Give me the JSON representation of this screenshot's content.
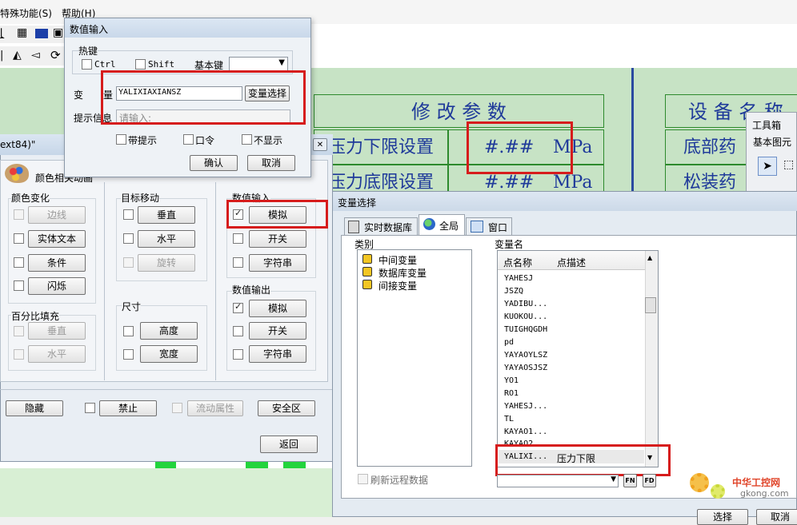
{
  "menubar": {
    "special": "特殊功能(S)",
    "help": "帮助(H)"
  },
  "hmi": {
    "panel_title": "修 改 参 数",
    "row1_label": "压力下限设置",
    "row1_value": "#.##",
    "row1_unit": "MPa",
    "row2_label": "压力底限设置",
    "row2_value": "#.##",
    "row2_unit": "MPa",
    "equip_title": "设 备 名 称",
    "equip_row1": "底部药",
    "equip_row2": "松装药"
  },
  "toolbox": {
    "title": "工具箱",
    "section": "基本图元"
  },
  "numeric_dialog": {
    "title": "数值输入",
    "hotkey_label": "热键",
    "ctrl_label": "Ctrl",
    "shift_label": "Shift",
    "basekey_label": "基本键",
    "var_label_a": "变",
    "var_label_b": "量",
    "var_value": "YALIXIAXIANSZ",
    "var_select_button": "变量选择",
    "prompt_label": "提示信息",
    "prompt_placeholder": "请输入:",
    "with_prompt": "带提示",
    "password": "口令",
    "no_display": "不显示",
    "ok": "确认",
    "cancel": "取消"
  },
  "animation_dialog": {
    "title_fragment": "ext84)\"",
    "close_glyph": "✕",
    "tab_color": "颜色相关动画",
    "color_change": "颜色变化",
    "edge": "边线",
    "solid_text": "实体文本",
    "condition": "条件",
    "blink": "闪烁",
    "percent_fill": "百分比填充",
    "vertical": "垂直",
    "horizontal": "水平",
    "target_move": "目标移动",
    "move_vertical": "垂直",
    "move_horizontal": "水平",
    "rotate": "旋转",
    "size": "尺寸",
    "height": "高度",
    "width": "宽度",
    "value_input": "数值输入",
    "in_analog": "模拟",
    "in_switch": "开关",
    "in_string": "字符串",
    "value_output": "数值输出",
    "out_analog": "模拟",
    "out_switch": "开关",
    "out_string": "字符串",
    "hide": "隐藏",
    "disable": "禁止",
    "flow_attr": "流动属性",
    "safety_zone": "安全区",
    "back": "返回"
  },
  "var_dialog": {
    "title": "变量选择",
    "tab_realtime": "实时数据库",
    "tab_global": "全局",
    "tab_window": "窗口",
    "category_label": "类别",
    "categories": [
      "中间变量",
      "数据库变量",
      "间接变量"
    ],
    "varname_label": "变量名",
    "col_point": "点名称",
    "col_desc": "点描述",
    "variables": [
      "YAHESJ",
      "JSZQ",
      "YADIBU...",
      "KUOKOU...",
      "TUIGHQGDH",
      "pd",
      "YAYAOYLSZ",
      "YAYAOSJSZ",
      "YO1",
      "RO1",
      "YAHESJ...",
      "TL",
      "KAYAO1...",
      "KAYAO2..."
    ],
    "selected_name": "YALIXI...",
    "selected_desc": "压力下限",
    "refresh_remote": "刷新远程数据",
    "fn_button": "FN",
    "fd_button": "FD",
    "select_button": "选择",
    "cancel_button": "取消"
  },
  "watermark": {
    "brand": "中华工控网",
    "url": "gkong.com"
  }
}
